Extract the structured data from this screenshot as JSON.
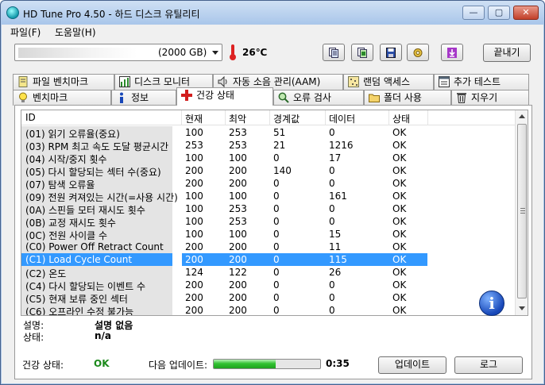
{
  "window": {
    "title": "HD Tune Pro 4.50 - 하드 디스크 유틸리티",
    "minimize_glyph": "—",
    "maximize_glyph": "▢",
    "close_glyph": "✕"
  },
  "menu": [
    "파일(F)",
    "도움말(H)"
  ],
  "toolbar": {
    "drive_value": "(2000 GB)",
    "temperature": "26℃",
    "exit_label": "끝내기",
    "buttons": [
      "copy-text-icon",
      "copy-screenshot-icon",
      "save-icon",
      "options-icon",
      "download-icon"
    ]
  },
  "tabs_row1": [
    {
      "label": "파일 벤치마크",
      "icon": "file-benchmark-icon"
    },
    {
      "label": "디스크 모니터",
      "icon": "disk-monitor-icon"
    },
    {
      "label": "자동 소음 관리(AAM)",
      "icon": "speaker-icon"
    },
    {
      "label": "랜덤 액세스",
      "icon": "random-access-icon"
    },
    {
      "label": "추가 테스트",
      "icon": "extra-tests-icon"
    }
  ],
  "tabs_row2": [
    {
      "label": "벤치마크",
      "icon": "lightbulb-icon"
    },
    {
      "label": "정보",
      "icon": "info-icon"
    },
    {
      "label": "건강 상태",
      "icon": "health-cross-icon"
    },
    {
      "label": "오류 검사",
      "icon": "magnifier-icon"
    },
    {
      "label": "폴더 사용",
      "icon": "folder-icon"
    },
    {
      "label": "지우기",
      "icon": "trash-icon"
    }
  ],
  "smart": {
    "columns": [
      "ID",
      "현재",
      "최악",
      "경계값",
      "데이터",
      "상태"
    ],
    "rows": [
      [
        "(01) 읽기 오류율(중요)",
        "100",
        "253",
        "51",
        "0",
        "OK"
      ],
      [
        "(03) RPM 최고 속도 도달 평균시간",
        "253",
        "253",
        "21",
        "1216",
        "OK"
      ],
      [
        "(04) 시작/중지 횟수",
        "100",
        "100",
        "0",
        "17",
        "OK"
      ],
      [
        "(05) 다시 할당되는 섹터 수(중요)",
        "200",
        "200",
        "140",
        "0",
        "OK"
      ],
      [
        "(07) 탐색 오류율",
        "200",
        "200",
        "0",
        "0",
        "OK"
      ],
      [
        "(09) 전원 켜져있는 시간(=사용 시간)",
        "100",
        "100",
        "0",
        "161",
        "OK"
      ],
      [
        "(0A) 스핀들 모터 재시도 횟수",
        "100",
        "253",
        "0",
        "0",
        "OK"
      ],
      [
        "(0B) 교정 재시도 횟수",
        "100",
        "253",
        "0",
        "0",
        "OK"
      ],
      [
        "(0C) 전원 사이클 수",
        "100",
        "100",
        "0",
        "15",
        "OK"
      ],
      [
        "(C0) Power Off Retract Count",
        "200",
        "200",
        "0",
        "11",
        "OK"
      ],
      [
        "(C1) Load Cycle Count",
        "200",
        "200",
        "0",
        "115",
        "OK"
      ],
      [
        "(C2) 온도",
        "124",
        "122",
        "0",
        "26",
        "OK"
      ],
      [
        "(C4) 다시 할당되는 이벤트 수",
        "200",
        "200",
        "0",
        "0",
        "OK"
      ],
      [
        "(C5) 현재 보류 중인 섹터",
        "200",
        "200",
        "0",
        "0",
        "OK"
      ],
      [
        "(C6) 오프라인 수정 불가능",
        "200",
        "200",
        "0",
        "0",
        "OK"
      ]
    ],
    "selected_index": 10
  },
  "details": {
    "desc_label": "설명:",
    "desc_value": "설명 없음",
    "state_label": "상태:",
    "state_value": "n/a"
  },
  "status": {
    "health_label": "건강 상태:",
    "health_value": "OK",
    "next_update_label": "다음 업데이트:",
    "progress": 0.58,
    "countdown": "0:35",
    "update_button": "업데이트",
    "log_button": "로그"
  }
}
